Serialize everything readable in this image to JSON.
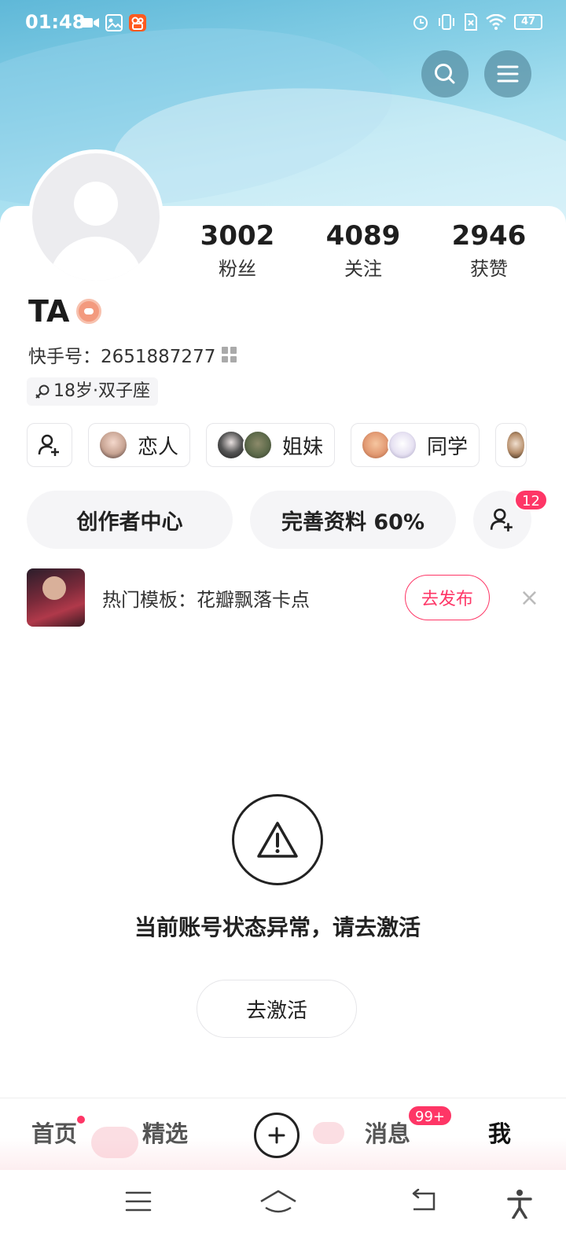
{
  "status_bar": {
    "time": "01:48",
    "battery": "47",
    "icons": [
      "video-icon",
      "gallery-icon",
      "kuaishou-app-icon",
      "alarm-icon",
      "vibrate-icon",
      "sim-off-icon",
      "wifi-icon",
      "battery-icon"
    ]
  },
  "header": {
    "search_icon": "search-icon",
    "menu_icon": "menu-icon"
  },
  "profile": {
    "stats": [
      {
        "value": "3002",
        "label": "粉丝"
      },
      {
        "value": "4089",
        "label": "关注"
      },
      {
        "value": "2946",
        "label": "获赞"
      }
    ],
    "name": "TA",
    "kuaishou_id": "快手号：2651887277",
    "tag": "18岁·双子座"
  },
  "relations": [
    {
      "label": "恋人"
    },
    {
      "label": "姐妹"
    },
    {
      "label": "同学"
    }
  ],
  "actions": {
    "creator_center": "创作者中心",
    "profile_complete": "完善资料 60%",
    "friend_badge": "12"
  },
  "promo": {
    "text": "热门模板：花瓣飘落卡点",
    "button": "去发布",
    "close": "×"
  },
  "notice": {
    "message": "当前账号状态异常，请去激活",
    "button": "去激活"
  },
  "bottom_nav": {
    "home": "首页",
    "featured": "精选",
    "messages": "消息",
    "messages_badge": "99+",
    "me": "我"
  },
  "colors": {
    "accent": "#fe3666",
    "header_sky": "#86cfe6"
  }
}
